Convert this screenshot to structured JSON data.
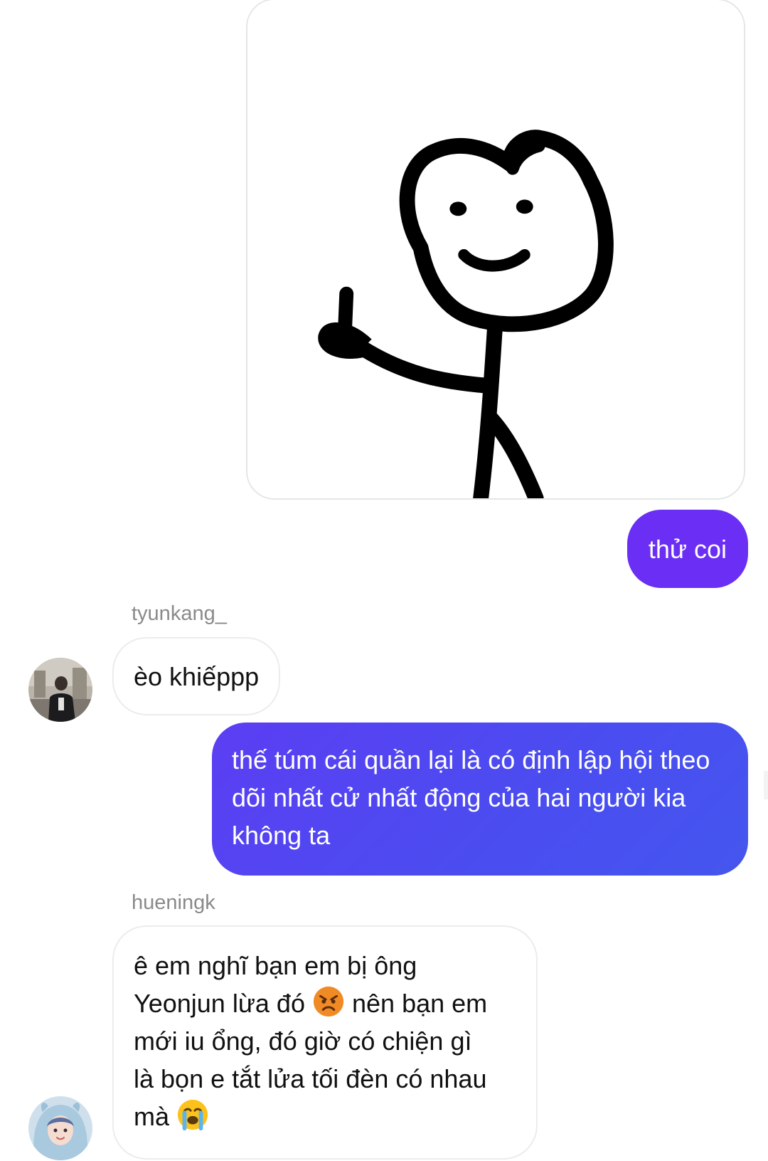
{
  "messages": {
    "sent_image": {
      "description_icon": "stick-figure-middle-finger-image"
    },
    "sent_1": "thử coi",
    "sender_1": "tyunkang_",
    "received_1": "èo khiếppp",
    "sent_2": "thế túm cái quần lại là có định lập hội theo dõi nhất cử nhất động của hai người kia không ta",
    "sender_2": "hueningk",
    "received_2": {
      "line_1": "ê em nghĩ bạn em bị ông",
      "line_2_a": "Yeonjun lừa đó",
      "line_2_b": "nên bạn em",
      "line_3": "mới iu ổng, đó giờ có chiện gì",
      "line_4": "là bọn e tắt lửa tối đèn có nhau",
      "line_5": "mà"
    }
  },
  "colors": {
    "sent_bubble_short": "#6a2ef4",
    "sent_bubble_long": "#4a4df0",
    "sender_name": "#8a8a8a",
    "received_border": "#ececec"
  },
  "icons": {
    "angry_emoji": "angry-face-icon",
    "crying_emoji": "loudly-crying-face-icon"
  }
}
